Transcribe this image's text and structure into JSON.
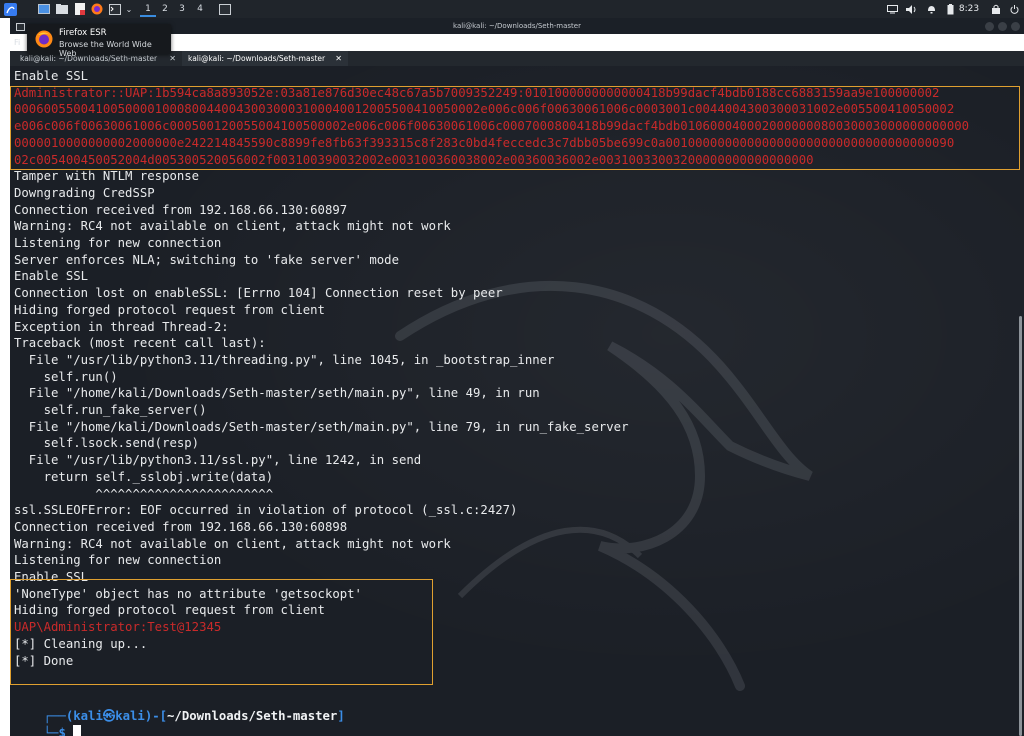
{
  "panel": {
    "workspaces": [
      "1",
      "2",
      "3",
      "4"
    ],
    "clock": "8:23",
    "icons": [
      "kali-menu-icon",
      "desktop-icon",
      "files-icon",
      "text-editor-icon",
      "firefox-icon",
      "terminal-icon"
    ]
  },
  "window": {
    "title": "kali@kali: ~/Downloads/Seth-master",
    "menu_fi": "Fi"
  },
  "tooltip": {
    "title": "Firefox ESR",
    "subtitle": "Browse the World Wide Web"
  },
  "tabs": [
    {
      "label": "kali@kali: ~/Downloads/Seth-master",
      "active": false
    },
    {
      "label": "kali@kali: ~/Downloads/Seth-master",
      "active": true
    }
  ],
  "terminal": {
    "lines": [
      "Enable SSL",
      "Administrator::UAP:1b594ca8a893052e:03a81e876d30ec48c67a5b7009352249:0101000000000000418b99dacf4bdb0188cc6883159aa9e100000002",
      "000600550041005000010008004400430030003100040012005500410050002e006c006f00630061006c0003001c0044004300300031002e005500410050002",
      "e006c006f00630061006c000500120055004100500002e006c006f00630061006c0007000800418b99dacf4bdb010600040002000000080030003000000000000",
      "0000010000000002000000e242214845590c8899fe8fb63f393315c8f283c0bd4feccedc3c7dbb05be699c0a001000000000000000000000000000000000090",
      "02c005400450052004d005300520056002f003100390032002e003100360038002e00360036002e00310033003200000000000000000",
      "Tamper with NTLM response",
      "Downgrading CredSSP",
      "Connection received from 192.168.66.130:60897",
      "Warning: RC4 not available on client, attack might not work",
      "Listening for new connection",
      "Server enforces NLA; switching to 'fake server' mode",
      "Enable SSL",
      "Connection lost on enableSSL: [Errno 104] Connection reset by peer",
      "Hiding forged protocol request from client",
      "Exception in thread Thread-2:",
      "Traceback (most recent call last):",
      "  File \"/usr/lib/python3.11/threading.py\", line 1045, in _bootstrap_inner",
      "    self.run()",
      "  File \"/home/kali/Downloads/Seth-master/seth/main.py\", line 49, in run",
      "    self.run_fake_server()",
      "  File \"/home/kali/Downloads/Seth-master/seth/main.py\", line 79, in run_fake_server",
      "    self.lsock.send(resp)",
      "  File \"/usr/lib/python3.11/ssl.py\", line 1242, in send",
      "    return self._sslobj.write(data)",
      "           ^^^^^^^^^^^^^^^^^^^^^^^^",
      "ssl.SSLEOFError: EOF occurred in violation of protocol (_ssl.c:2427)",
      "Connection received from 192.168.66.130:60898",
      "Warning: RC4 not available on client, attack might not work",
      "Listening for new connection",
      "Enable SSL",
      "'NoneType' object has no attribute 'getsockopt'",
      "Hiding forged protocol request from client",
      "UAP\\Administrator:Test@12345",
      "[*] Cleaning up...",
      "[*] Done"
    ],
    "red_lines": [
      1,
      2,
      3,
      4,
      5,
      33
    ],
    "prompt": {
      "corner_top": "┌──(",
      "user": "kali",
      "at": "㉿",
      "host": "kali",
      "close_paren": ")-[",
      "path": "~/Downloads/Seth-master",
      "close_bracket": "]",
      "corner_bottom": "└─",
      "symbol": "$"
    },
    "highlight_color": "#e0a030",
    "text_color": "#e8eaec",
    "red_color": "#c92a2a",
    "prompt_blue": "#3b8ee8"
  }
}
